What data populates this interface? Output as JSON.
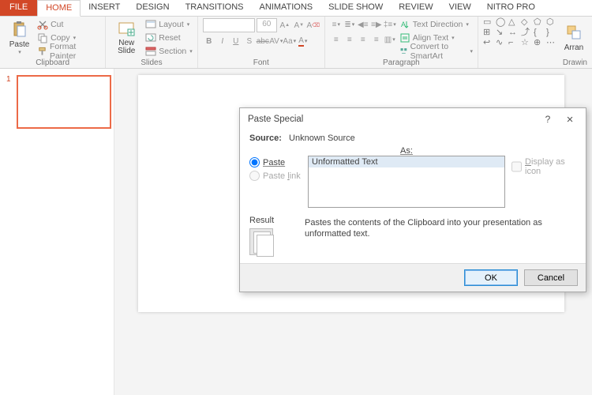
{
  "tabs": [
    "FILE",
    "HOME",
    "INSERT",
    "DESIGN",
    "TRANSITIONS",
    "ANIMATIONS",
    "SLIDE SHOW",
    "REVIEW",
    "VIEW",
    "NITRO PRO"
  ],
  "active_tab": 1,
  "ribbon": {
    "clipboard": {
      "paste": "Paste",
      "cut": "Cut",
      "copy": "Copy",
      "format_painter": "Format Painter",
      "label": "Clipboard"
    },
    "slides": {
      "new_slide": "New\nSlide",
      "layout": "Layout",
      "reset": "Reset",
      "section": "Section",
      "label": "Slides"
    },
    "font": {
      "size": "60",
      "label": "Font"
    },
    "paragraph": {
      "text_direction": "Text Direction",
      "align_text": "Align Text",
      "convert_smartart": "Convert to SmartArt",
      "label": "Paragraph"
    },
    "drawing": {
      "arrange": "Arran",
      "label": "Drawin"
    }
  },
  "thumb_number": "1",
  "dialog": {
    "title": "Paste Special",
    "source_label": "Source:",
    "source_value": "Unknown Source",
    "as_label": "As:",
    "paste_label": "Paste",
    "paste_link_label": "Paste link",
    "list_item": "Unformatted Text",
    "display_icon": "Display as icon",
    "result_label": "Result",
    "result_text": "Pastes the contents of the Clipboard into your presentation as unformatted text.",
    "ok": "OK",
    "cancel": "Cancel"
  }
}
